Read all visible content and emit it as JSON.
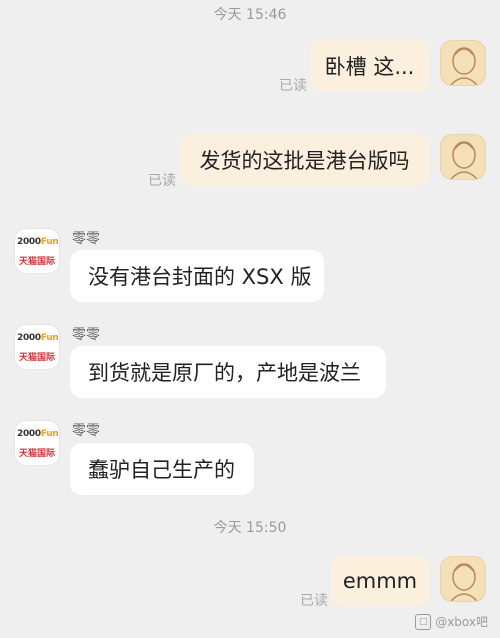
{
  "timestamps": [
    "今天 15:46",
    "今天 15:50"
  ],
  "status_read": "已读",
  "contact_name": "零零",
  "contact_brand": {
    "top": "2000Fun",
    "bottom": "天猫国际"
  },
  "messages": [
    {
      "from": "self",
      "text": "卧槽 这..."
    },
    {
      "from": "self",
      "text": "发货的这批是港台版吗"
    },
    {
      "from": "other",
      "text": "没有港台封面的 XSX 版"
    },
    {
      "from": "other",
      "text": "到货就是原厂的，产地是波兰"
    },
    {
      "from": "other",
      "text": "蠢驴自己生产的"
    },
    {
      "from": "self",
      "text": "emmm"
    }
  ],
  "watermark": "@xbox吧",
  "colors": {
    "background": "#efefef",
    "self_bubble": "#fbf0de",
    "other_bubble": "#ffffff"
  }
}
